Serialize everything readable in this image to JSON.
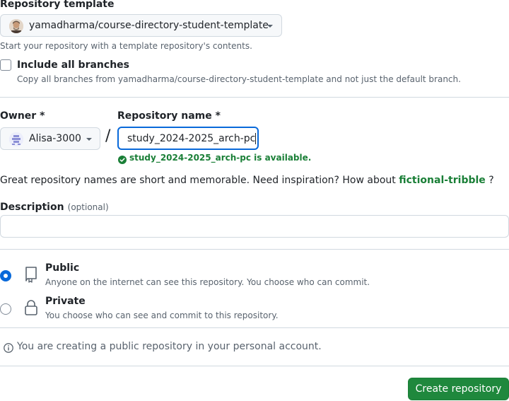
{
  "template": {
    "label": "Repository template",
    "selected": "yamadharma/course-directory-student-template",
    "hint": "Start your repository with a template repository's contents."
  },
  "branches": {
    "label": "Include all branches",
    "hint": "Copy all branches from yamadharma/course-directory-student-template and not just the default branch.",
    "checked": false
  },
  "owner": {
    "label": "Owner *",
    "value": "Alisa-3000"
  },
  "separator": "/",
  "repo_name": {
    "label": "Repository name *",
    "value": "study_2024-2025_arch-pc",
    "status": "study_2024-2025_arch-pc is available."
  },
  "inspiration": {
    "text": "Great repository names are short and memorable. Need inspiration? How about",
    "suggestion": "fictional-tribble",
    "tail": "?"
  },
  "description": {
    "label": "Description",
    "optional": "(optional)",
    "value": ""
  },
  "visibility": {
    "options": [
      {
        "label": "Public",
        "hint": "Anyone on the internet can see this repository. You choose who can commit.",
        "selected": true
      },
      {
        "label": "Private",
        "hint": "You choose who can see and commit to this repository.",
        "selected": false
      }
    ]
  },
  "notice": "You are creating a public repository in your personal account.",
  "submit_label": "Create repository",
  "colors": {
    "accent": "#0969da",
    "success": "#1a7f37",
    "primary_button": "#1f883d",
    "border": "#d1d9e0"
  }
}
